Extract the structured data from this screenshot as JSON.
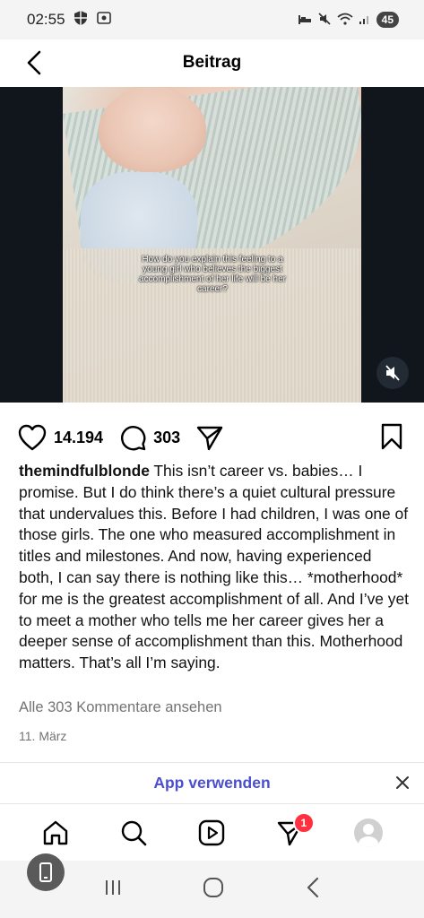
{
  "status_bar": {
    "time": "02:55",
    "battery": "45"
  },
  "header": {
    "title": "Beitrag"
  },
  "video": {
    "overlay_text": "How do you explain this feeling to a young girl who believes the biggest accomplishment of her life will be her career?"
  },
  "actions": {
    "likes": "14.194",
    "comments": "303"
  },
  "post": {
    "username": "themindfulblonde",
    "caption": "This isn’t career vs. babies… I promise. But I do think there’s a quiet cultural pressure that undervalues this. Before I had children, I was one of those girls. The one who measured accomplishment in titles and milestones. And now, having experienced both, I can say there is nothing like this… *motherhood* for me is the greatest accomplishment of all. And I’ve yet to meet a mother who tells me her career gives her a deeper sense of accomplishment than this. Motherhood matters. That’s all I’m saying.",
    "view_comments": "Alle 303 Kommentare ansehen",
    "date": "11. März"
  },
  "app_banner": {
    "label": "App verwenden"
  },
  "bottom_nav": {
    "notifications_badge": "1"
  },
  "colors": {
    "accent": "#4a4fd0",
    "badge": "#ff3040",
    "muted_text": "#737373"
  }
}
